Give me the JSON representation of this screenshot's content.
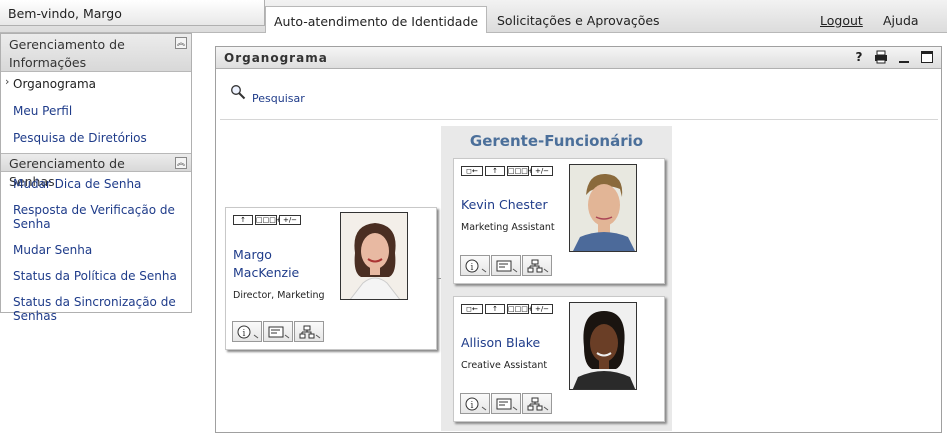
{
  "header": {
    "welcome": "Bem-vindo, Margo",
    "tabs": [
      {
        "label": "Auto-atendimento de Identidade",
        "active": true
      },
      {
        "label": "Solicitações e Aprovações",
        "active": false
      }
    ],
    "logout": "Logout",
    "help": "Ajuda"
  },
  "sidebar": {
    "sections": [
      {
        "title": "Gerenciamento de Informações",
        "items": [
          {
            "label": "Organograma",
            "selected": true
          },
          {
            "label": "Meu Perfil"
          },
          {
            "label": "Pesquisa de Diretórios"
          }
        ]
      },
      {
        "title": "Gerenciamento de Senhas",
        "items": [
          {
            "label": "Mudar Dica de Senha"
          },
          {
            "label": "Resposta de Verificação de Senha"
          },
          {
            "label": "Mudar Senha"
          },
          {
            "label": "Status da Política de Senha"
          },
          {
            "label": "Status da Sincronização de Senhas"
          }
        ]
      }
    ]
  },
  "portlet": {
    "title": "Organograma",
    "controls": {
      "help": "?",
      "print": "print-icon",
      "minimize": "minimize-icon",
      "maximize": "maximize-icon"
    },
    "search_label": "Pesquisar",
    "group_title": "Gerente-Funcionário",
    "manager": {
      "name_line1": "Margo",
      "name_line2": "MacKenzie",
      "title": "Director, Marketing"
    },
    "employees": [
      {
        "name": "Kevin Chester",
        "title": "Marketing Assistant"
      },
      {
        "name": "Allison Blake",
        "title": "Creative Assistant"
      }
    ],
    "mini_buttons": {
      "up": "↑",
      "add_team": "□□□+",
      "expand": "+/−",
      "left": "◻←"
    }
  },
  "colors": {
    "link": "#1f3c8a",
    "group_title": "#4b6f9a",
    "group_bg": "#e9e9e9"
  }
}
